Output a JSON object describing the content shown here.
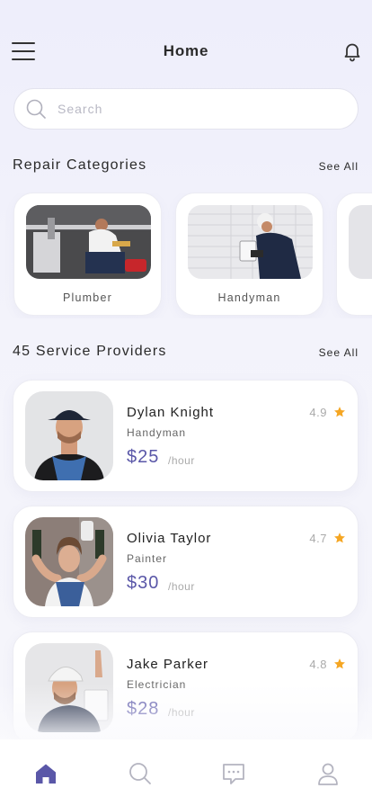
{
  "header": {
    "title": "Home"
  },
  "search": {
    "placeholder": "Search"
  },
  "categories_section": {
    "title": "Repair Categories",
    "see_all": "See All",
    "items": [
      {
        "label": "Plumber"
      },
      {
        "label": "Handyman"
      },
      {
        "label": ""
      }
    ]
  },
  "providers_section": {
    "title": "45 Service Providers",
    "see_all": "See All",
    "items": [
      {
        "name": "Dylan Knight",
        "role": "Handyman",
        "price": "$25",
        "unit": "/hour",
        "rating": "4.9"
      },
      {
        "name": "Olivia Taylor",
        "role": "Painter",
        "price": "$30",
        "unit": "/hour",
        "rating": "4.7"
      },
      {
        "name": "Jake Parker",
        "role": "Electrician",
        "price": "$28",
        "unit": "/hour",
        "rating": "4.8"
      }
    ]
  },
  "colors": {
    "accent": "#5a57a8",
    "star": "#f5a623",
    "background": "#f1f1fa"
  },
  "icons": {
    "menu": "hamburger-menu-icon",
    "notifications": "bell-icon",
    "search": "search-icon",
    "rating": "star-icon",
    "tabs": [
      "home-icon",
      "search-icon",
      "chat-icon",
      "profile-icon"
    ]
  }
}
